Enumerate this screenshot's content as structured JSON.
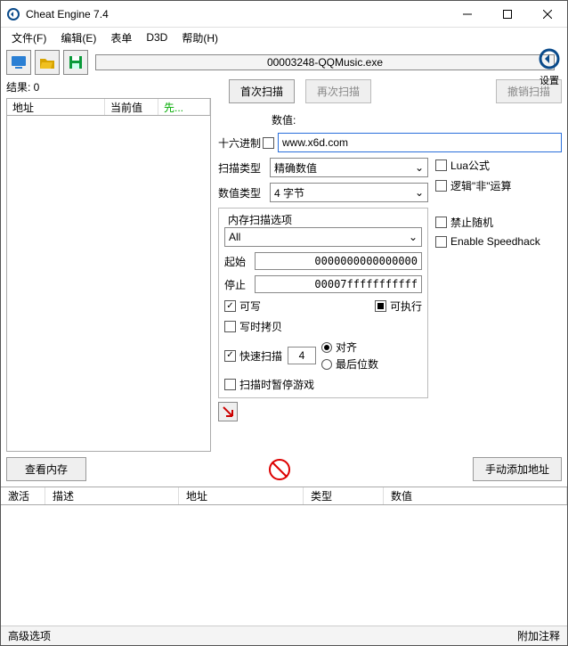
{
  "title": "Cheat Engine 7.4",
  "menus": {
    "file": "文件(F)",
    "edit": "编辑(E)",
    "table": "表单",
    "d3d": "D3D",
    "help": "帮助(H)"
  },
  "process_name": "00003248-QQMusic.exe",
  "settings_label": "设置",
  "results_label": "结果: 0",
  "cols": {
    "addr": "地址",
    "current": "当前值",
    "prev": "先..."
  },
  "scan": {
    "first": "首次扫描",
    "next": "再次扫描",
    "undo": "撤销扫描",
    "value_label": "数值:",
    "hex_label": "十六进制",
    "value_input": "www.x6d.com",
    "scantype_label": "扫描类型",
    "scantype_value": "精确数值",
    "valuetype_label": "数值类型",
    "valuetype_value": "4 字节",
    "lua_label": "Lua公式",
    "not_label": "逻辑\"非\"运算",
    "mem_label": "内存扫描选项",
    "mem_value": "All",
    "start_label": "起始",
    "start_value": "0000000000000000",
    "stop_label": "停止",
    "stop_value": "00007fffffffffff",
    "writable": "可写",
    "executable": "可执行",
    "cow": "写时拷贝",
    "norand": "禁止随机",
    "speedhack": "Enable Speedhack",
    "fast_label": "快速扫描",
    "fast_value": "4",
    "align": "对齐",
    "lastdigits": "最后位数",
    "pause_label": "扫描时暂停游戏"
  },
  "buttons": {
    "viewmem": "查看内存",
    "addmanual": "手动添加地址"
  },
  "table": {
    "active": "激活",
    "desc": "描述",
    "addr": "地址",
    "type": "类型",
    "value": "数值"
  },
  "bottom": {
    "adv": "高级选项",
    "comment": "附加注释"
  }
}
